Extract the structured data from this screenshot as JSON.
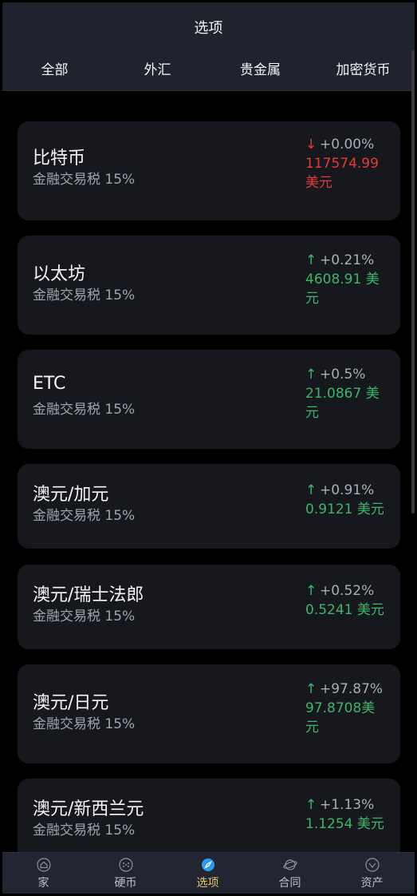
{
  "header": {
    "title": "选项"
  },
  "tabs": [
    "全部",
    "外汇",
    "贵金属",
    "加密货币"
  ],
  "items": [
    {
      "name": "比特币",
      "tax": "金融交易税 15%",
      "change": "+0.00%",
      "price_line1": "117574.99",
      "price_line2": "美元",
      "direction": "down"
    },
    {
      "name": "以太坊",
      "tax": "金融交易税 15%",
      "change": "+0.21%",
      "price_line1": "4608.91 美",
      "price_line2": "元",
      "direction": "up"
    },
    {
      "name": "ETC",
      "tax": "金融交易税 15%",
      "change": "+0.5%",
      "price_line1": "21.0867 美",
      "price_line2": "元",
      "direction": "up"
    },
    {
      "name": "澳元/加元",
      "tax": "金融交易税 15%",
      "change": "+0.91%",
      "price_line1": "0.9121 美元",
      "price_line2": "",
      "direction": "up"
    },
    {
      "name": "澳元/瑞士法郎",
      "tax": "金融交易税 15%",
      "change": "+0.52%",
      "price_line1": "0.5241 美元",
      "price_line2": "",
      "direction": "up"
    },
    {
      "name": "澳元/日元",
      "tax": "金融交易税 15%",
      "change": "+97.87%",
      "price_line1": "97.8708美",
      "price_line2": "元",
      "direction": "up"
    },
    {
      "name": "澳元/新西兰元",
      "tax": "金融交易税 15%",
      "change": "+1.13%",
      "price_line1": "1.1254 美元",
      "price_line2": "",
      "direction": "up"
    }
  ],
  "nav": {
    "items": [
      {
        "label": "家",
        "icon": "home-icon"
      },
      {
        "label": "硬币",
        "icon": "coin-icon"
      },
      {
        "label": "选项",
        "icon": "compass-icon"
      },
      {
        "label": "合同",
        "icon": "planet-icon"
      },
      {
        "label": "资产",
        "icon": "wallet-icon"
      }
    ],
    "active_index": 2
  },
  "colors": {
    "up": "#3fb46b",
    "down": "#e23b3b",
    "active_nav": "#e4c26a",
    "active_icon": "#2f9be8"
  }
}
